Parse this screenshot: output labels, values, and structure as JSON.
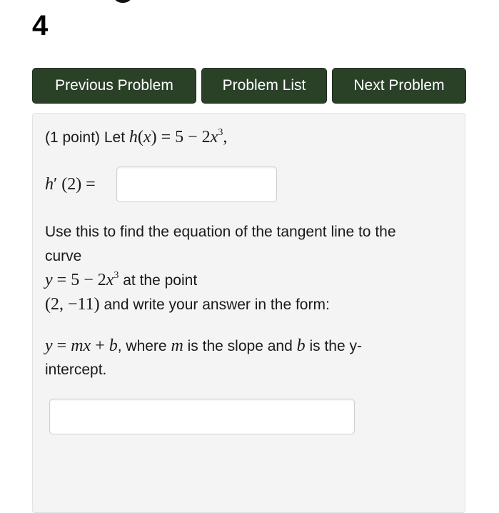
{
  "header": {
    "problem_number": "4"
  },
  "nav": {
    "previous_label": "Previous Problem",
    "list_label": "Problem List",
    "next_label": "Next Problem",
    "button_color": "#2a4128"
  },
  "problem": {
    "points": "(1 point) Let",
    "function_name": "h",
    "function_var": "x",
    "function_rhs": "= 5 − 2",
    "function_x": "x",
    "function_exp": "3",
    "function_trail": ",",
    "derivative_label_h": "h",
    "derivative_label_rest": "′ (2) =",
    "derivative_answer": {
      "value": "",
      "placeholder": ""
    },
    "instruction_line1": "Use this to find the equation of the tangent line to the",
    "instruction_line2": "curve",
    "curve_y": "y",
    "curve_rhs": "= 5 − 2",
    "curve_x": "x",
    "curve_exp": "3",
    "curve_tail": "at the point",
    "point": "(2, −11)",
    "point_tail": "and write your answer in the form:",
    "form_y": "y",
    "form_eq": "=",
    "form_mx": "mx",
    "form_plus": "+",
    "form_b": "b",
    "form_text1": ", where",
    "form_m": "m",
    "form_text2": "is the slope and",
    "form_b2": "b",
    "form_text3": "is the y-",
    "form_line2": "intercept.",
    "tangent_answer": {
      "value": "",
      "placeholder": ""
    }
  }
}
